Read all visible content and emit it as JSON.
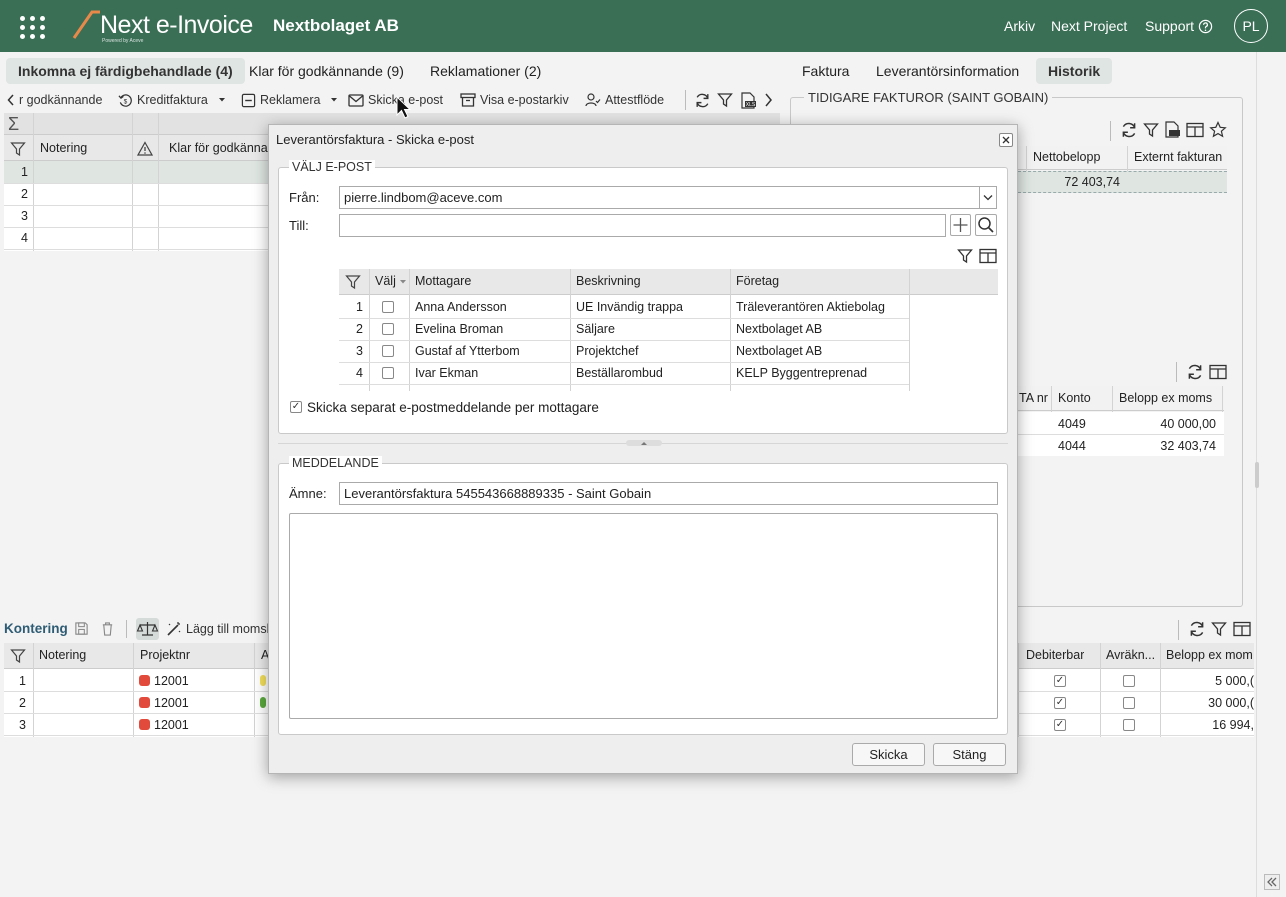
{
  "app": {
    "logo_text": "Next e-Invoice",
    "logo_tagline": "Powered by Aceve",
    "company": "Nextbolaget AB",
    "nav": [
      "Arkiv",
      "Next Project",
      "Support"
    ],
    "avatar": "PL",
    "brand_color": "#3a6f56"
  },
  "left_tabs": [
    "Inkomna ej färdigbehandlade (4)",
    "Klar för godkännande (9)",
    "Reklamationer (2)"
  ],
  "toolbar": {
    "partial_item": "r godkännande",
    "kreditfaktura": "Kreditfaktura",
    "reklamera": "Reklamera",
    "skicka_epost": "Skicka e-post",
    "visa_epostarkiv": "Visa e-postarkiv",
    "attestflode": "Attestflöde"
  },
  "main_grid": {
    "sum_symbol": "Σ",
    "columns": [
      "Notering",
      "Klar för godkänna"
    ],
    "row_numbers": [
      "1",
      "2",
      "3",
      "4"
    ]
  },
  "right_tabs": [
    "Faktura",
    "Leverantörsinformation",
    "Historik"
  ],
  "history": {
    "title": "TIDIGARE FAKTUROR (SAINT GOBAIN)",
    "columns": [
      "Nettobelopp",
      "Externt fakturan"
    ],
    "rows": [
      {
        "netto": "72 403,74"
      }
    ]
  },
  "coding_right": {
    "columns": [
      "TA nr",
      "Konto",
      "Belopp ex moms"
    ],
    "rows": [
      {
        "konto": "4049",
        "belopp": "40 000,00"
      },
      {
        "konto": "4044",
        "belopp": "32 403,74"
      }
    ]
  },
  "kontering": {
    "title": "Kontering",
    "add_vat": "Lägg till momsl",
    "columns": [
      "Notering",
      "Projektnr",
      "A"
    ],
    "right_columns": [
      "Debiterbar",
      "Avräkn...",
      "Belopp ex mom"
    ],
    "rows": [
      {
        "n": "1",
        "projekt": "12001",
        "belopp": "5 000,("
      },
      {
        "n": "2",
        "projekt": "12001",
        "belopp": "30 000,("
      },
      {
        "n": "3",
        "projekt": "12001",
        "belopp": "16 994,"
      }
    ],
    "status_red": "#e24b3b",
    "status_yellow": "#f1df5a",
    "status_green": "#5aa83c"
  },
  "modal": {
    "title": "Leverantörsfaktura - Skicka e-post",
    "section_email": "VÄLJ E-POST",
    "from_label": "Från:",
    "from_value": "pierre.lindbom@aceve.com",
    "to_label": "Till:",
    "to_value": "",
    "recipients": {
      "columns": [
        "Välj",
        "Mottagare",
        "Beskrivning",
        "Företag"
      ],
      "rows": [
        {
          "n": "1",
          "name": "Anna Andersson",
          "desc": "UE Invändig trappa",
          "company": "Träleverantören Aktiebolag"
        },
        {
          "n": "2",
          "name": "Evelina Broman",
          "desc": "Säljare",
          "company": "Nextbolaget AB"
        },
        {
          "n": "3",
          "name": "Gustaf af Ytterbom",
          "desc": "Projektchef",
          "company": "Nextbolaget AB"
        },
        {
          "n": "4",
          "name": "Ivar Ekman",
          "desc": "Beställarombud",
          "company": "KELP Byggentreprenad"
        }
      ]
    },
    "separate_label": "Skicka separat e-postmeddelande per mottagare",
    "section_message": "MEDDELANDE",
    "subject_label": "Ämne:",
    "subject_value": "Leverantörsfaktura 545543668889335 - Saint Gobain",
    "body_value": "",
    "send_button": "Skicka",
    "close_button": "Stäng"
  }
}
